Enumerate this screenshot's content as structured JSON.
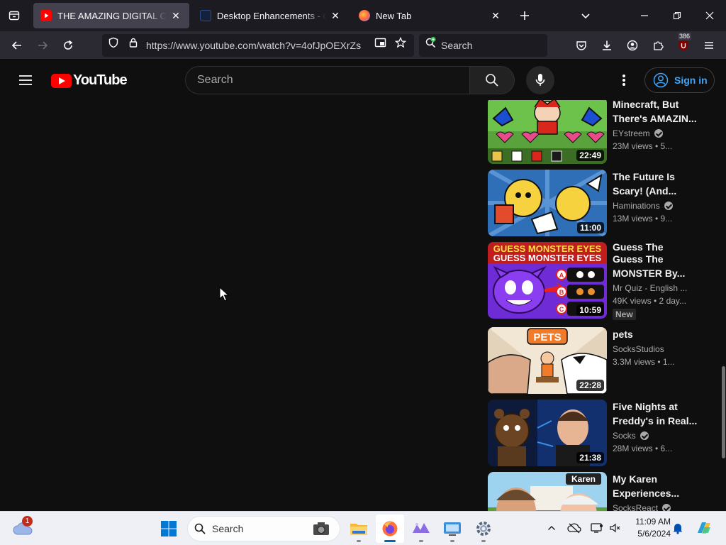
{
  "browser": {
    "tabs": [
      {
        "title": "THE AMAZING DIGITAL CIRCUS",
        "icon": "youtube-icon",
        "active": true,
        "close": "✕"
      },
      {
        "title": "Desktop Enhancements - Other",
        "icon": "page-icon",
        "active": false,
        "close": "✕"
      },
      {
        "title": "New Tab",
        "icon": "firefox-icon",
        "active": false,
        "close": "✕"
      }
    ],
    "url": "https://www.youtube.com/watch?v=4ofJpOEXrZs",
    "search_placeholder": "Search",
    "extension_badge": "386"
  },
  "youtube": {
    "search_placeholder": "Search",
    "sign_in_label": "Sign in",
    "logo_text": "YouTube"
  },
  "recommendations": [
    {
      "title": "Minecraft, But There's AMAZIN...",
      "channel": "EYstreem",
      "verified": true,
      "stats": "23M views  • 5...",
      "duration": "22:49",
      "badge": ""
    },
    {
      "title": "The Future Is Scary! (And...",
      "channel": "Haminations",
      "verified": true,
      "stats": "13M views  • 9...",
      "duration": "11:00",
      "badge": ""
    },
    {
      "title": "Guess The MONSTER By...",
      "title_overlap": "Guess The",
      "channel": "Mr Quiz - English ...",
      "verified": false,
      "stats": "49K views  • 2 day...",
      "duration": "10:59",
      "badge": "New"
    },
    {
      "title": "pets",
      "channel": "SocksStudios",
      "verified": false,
      "stats": "3.3M views  • 1...",
      "duration": "22:28",
      "badge": ""
    },
    {
      "title": "Five Nights at Freddy's in Real...",
      "channel": "Socks",
      "verified": true,
      "stats": "28M views  • 6...",
      "duration": "21:38",
      "badge": ""
    },
    {
      "title": "My Karen Experiences...",
      "channel": "SocksReact",
      "verified": true,
      "stats": "",
      "duration": "",
      "badge": ""
    }
  ],
  "thumb_text": {
    "guess_banner": "GUESS MONSTER EYES",
    "pets_sign": "PETS",
    "karen_sign": "Karen",
    "options": [
      "A",
      "B",
      "C"
    ]
  },
  "taskbar": {
    "search_placeholder": "Search",
    "weather_badge": "1",
    "time": "11:09 AM",
    "date": "5/6/2024"
  },
  "colors": {
    "yt_red": "#ff0000",
    "link_blue": "#3ea6ff",
    "firefox_bg": "#1c1b22",
    "taskbar_accent": "#0067c0"
  }
}
